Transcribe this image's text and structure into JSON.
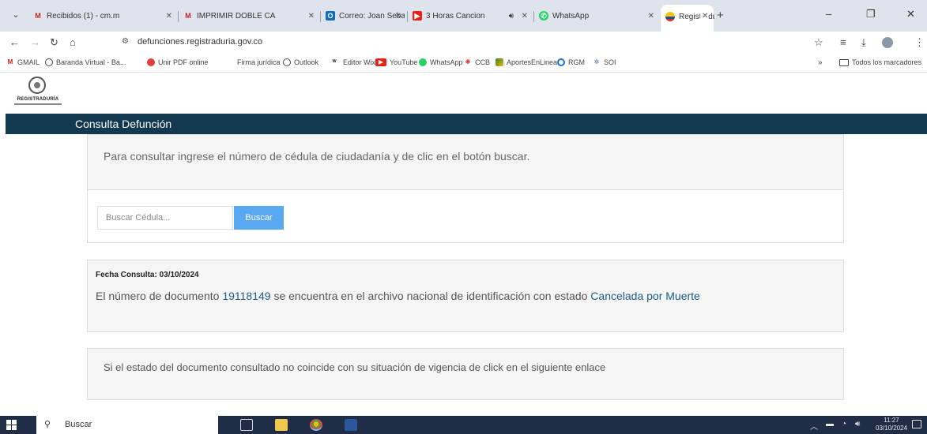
{
  "browser": {
    "tabs": [
      {
        "label": "Recibidos (1) - cm.m",
        "icon": "gmail-icon"
      },
      {
        "label": "IMPRIMIR DOBLE CA",
        "icon": "gmail-icon"
      },
      {
        "label": "Correo: Joan Sebasti",
        "icon": "outlook-icon"
      },
      {
        "label": "3 Horas Cancion",
        "icon": "youtube-icon"
      },
      {
        "label": "WhatsApp",
        "icon": "whatsapp-icon"
      },
      {
        "label": "Registraduría Nacion",
        "icon": "registraduria-icon"
      }
    ],
    "url": "defunciones.registraduria.gov.co",
    "bookmarks": [
      {
        "label": "GMAIL",
        "icon": "gmail-icon"
      },
      {
        "label": "Baranda Virtual - Ba...",
        "icon": "globe-icon"
      },
      {
        "label": "Unir PDF online",
        "icon": "pdf-icon"
      },
      {
        "label": "Firma jurídica",
        "icon": ""
      },
      {
        "label": "Outlook",
        "icon": "globe-icon"
      },
      {
        "label": "Editor Wix",
        "icon": "wix-icon"
      },
      {
        "label": "YouTube",
        "icon": "youtube-icon"
      },
      {
        "label": "WhatsApp",
        "icon": "whatsapp-icon"
      },
      {
        "label": "CCB",
        "icon": "ccb-icon"
      },
      {
        "label": "AportesEnLinea",
        "icon": "aportes-icon"
      },
      {
        "label": "RGM",
        "icon": "rgm-icon"
      },
      {
        "label": "SOI",
        "icon": "soi-icon"
      }
    ],
    "bookmarks_more": "»",
    "all_bookmarks": "Todos los marcadores"
  },
  "site": {
    "logo_text": "REGISTRADURÍA",
    "nav_title": "Consulta Defunción"
  },
  "consulta": {
    "instructions": "Para consultar ingrese el número de cédula de ciudadanía y de clic en el botón buscar.",
    "search_placeholder": "Buscar Cédula...",
    "search_button": "Buscar"
  },
  "resultado": {
    "fecha_label": "Fecha Consulta: 03/10/2024",
    "text_before": "El número de documento",
    "documento": "19118149",
    "text_middle": "se encuentra en el archivo nacional de identificación con estado",
    "estado": "Cancelada por Muerte"
  },
  "vigencia": {
    "text": "Si el estado del documento consultado no coincide con su situación de vigencia de click en el siguiente enlace"
  },
  "taskbar": {
    "search_label": "Buscar",
    "time": "11:27",
    "date": "03/10/2024"
  },
  "colors": {
    "navbar": "#12394f",
    "button": "#58a9f2",
    "link": "#1d5b8a",
    "taskbar": "#1f2e46"
  }
}
